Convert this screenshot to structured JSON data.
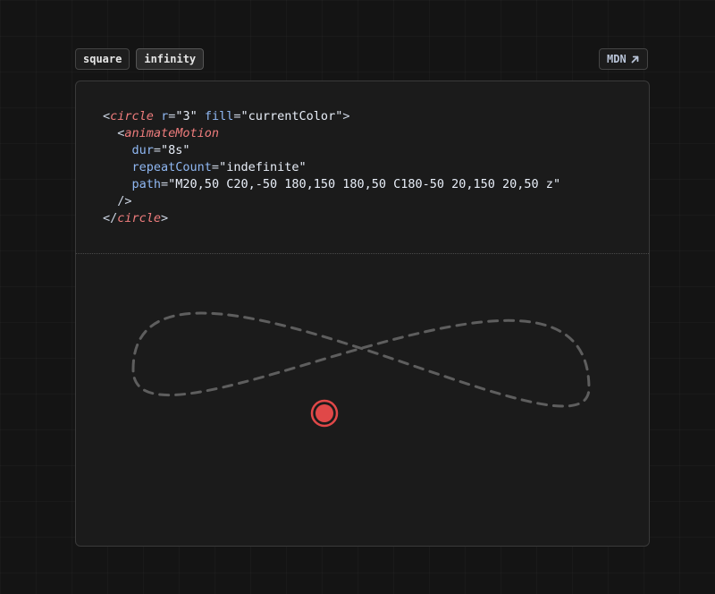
{
  "toolbar": {
    "tabs": [
      {
        "label": "square"
      },
      {
        "label": "infinity"
      }
    ],
    "mdn_label": "MDN"
  },
  "icons": {
    "mdn": "arrow-up-right-icon"
  },
  "code": {
    "lines": [
      [
        {
          "t": "punct",
          "v": "<"
        },
        {
          "t": "tag",
          "v": "circle"
        },
        {
          "t": "punct",
          "v": " "
        },
        {
          "t": "attr",
          "v": "r"
        },
        {
          "t": "punct",
          "v": "="
        },
        {
          "t": "str",
          "v": "\"3\""
        },
        {
          "t": "punct",
          "v": " "
        },
        {
          "t": "attr",
          "v": "fill"
        },
        {
          "t": "punct",
          "v": "="
        },
        {
          "t": "str",
          "v": "\"currentColor\""
        },
        {
          "t": "punct",
          "v": ">"
        }
      ],
      [
        {
          "t": "punct",
          "v": "  <"
        },
        {
          "t": "tag",
          "v": "animateMotion"
        }
      ],
      [
        {
          "t": "punct",
          "v": "    "
        },
        {
          "t": "attr",
          "v": "dur"
        },
        {
          "t": "punct",
          "v": "="
        },
        {
          "t": "str",
          "v": "\"8s\""
        }
      ],
      [
        {
          "t": "punct",
          "v": "    "
        },
        {
          "t": "attr",
          "v": "repeatCount"
        },
        {
          "t": "punct",
          "v": "="
        },
        {
          "t": "str",
          "v": "\"indefinite\""
        }
      ],
      [
        {
          "t": "punct",
          "v": "    "
        },
        {
          "t": "attr",
          "v": "path"
        },
        {
          "t": "punct",
          "v": "="
        },
        {
          "t": "str",
          "v": "\"M20,50 C20,-50 180,150 180,50 C180-50 20,150 20,50 z\""
        }
      ],
      [
        {
          "t": "punct",
          "v": "  />"
        }
      ],
      [
        {
          "t": "punct",
          "v": "</"
        },
        {
          "t": "tag",
          "v": "circle"
        },
        {
          "t": "punct",
          "v": ">"
        }
      ]
    ]
  },
  "colors": {
    "accent": "#e04848",
    "tag": "#f07d7d",
    "attribute": "#8fb7f2",
    "path_stroke": "#5e5e5e"
  }
}
